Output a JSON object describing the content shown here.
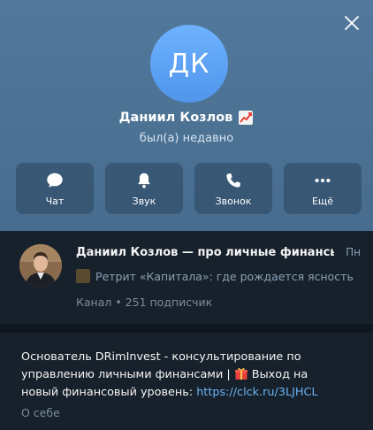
{
  "profile": {
    "initials": "ДК",
    "name": "Даниил Козлов",
    "name_emoji": "chart-increasing-icon",
    "status": "был(а) недавно"
  },
  "actions": [
    {
      "label": "Чат",
      "icon": "chat-icon"
    },
    {
      "label": "Звук",
      "icon": "bell-icon"
    },
    {
      "label": "Звонок",
      "icon": "phone-icon"
    },
    {
      "label": "Ещё",
      "icon": "more-icon"
    }
  ],
  "channel": {
    "title": "Даниил Козлов — про личные финансы",
    "time": "Пн",
    "last_message": "Ретрит «Капитала»: где рождается ясность",
    "meta": "Канал • 251 подписчик"
  },
  "about": {
    "text_before": "Основатель DRimInvest - консультирование по управлению личными финансами | ",
    "text_after": " Выход на новый финансовый уровень: ",
    "link": "https://clck.ru/3LJHCL",
    "label": "О себе"
  },
  "colors": {
    "header": "#4c7294",
    "avatar": "#5aa1f2",
    "link": "#6ab3f3",
    "background": "#17212b"
  }
}
